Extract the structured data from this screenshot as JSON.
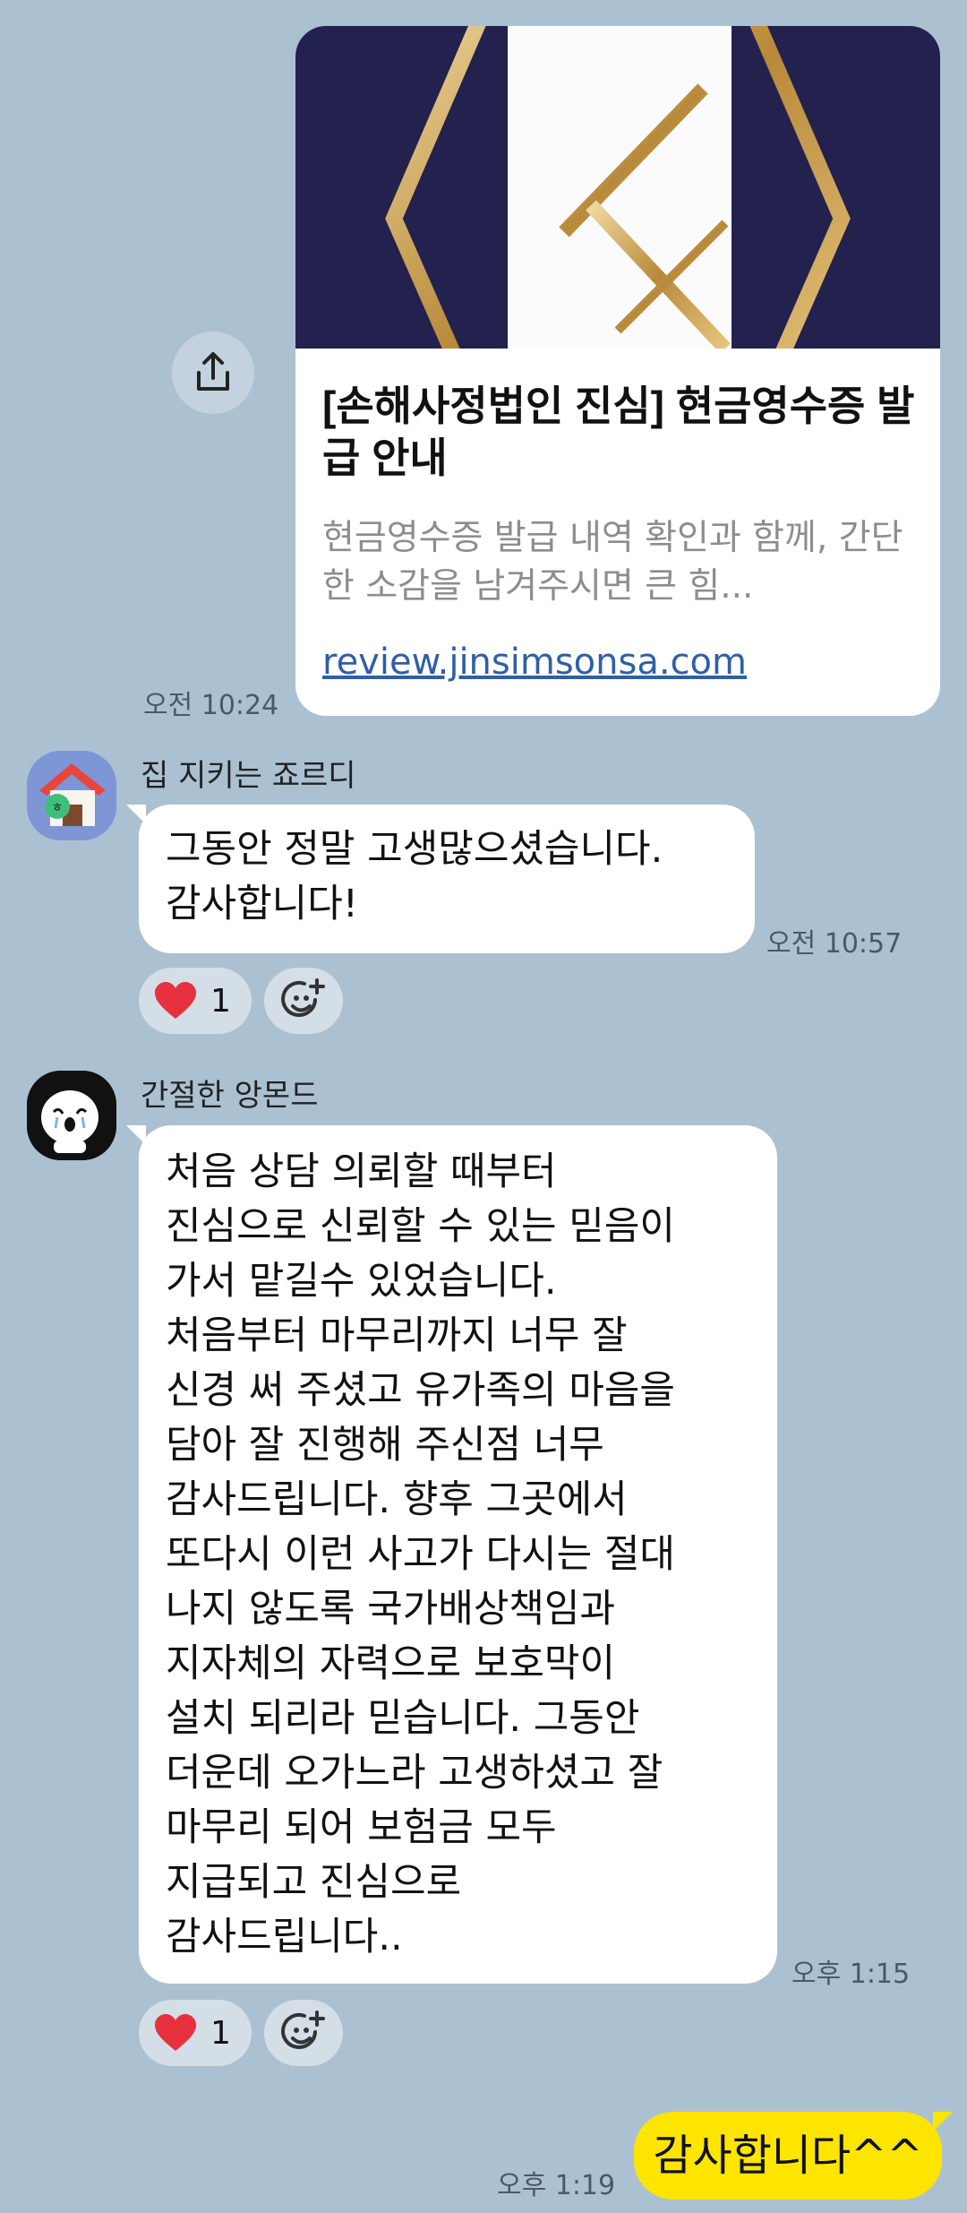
{
  "link_card": {
    "title": "[손해사정법인 진심] 현금영수증 발급 안내",
    "description": "현금영수증 발급 내역 확인과 함께, 간단한 소감을 남겨주시면 큰 힘...",
    "url": "review.jinsimsonsa.com",
    "time": "오전 10:24",
    "share_icon": "share-icon"
  },
  "messages": [
    {
      "sender": "집 지키는 죠르디",
      "avatar_icon": "house-character-avatar",
      "text": "그동안 정말 고생많으셨습니다.\n감사합니다!",
      "time": "오전 10:57",
      "reaction": {
        "icon": "heart-icon",
        "count": "1"
      },
      "add_reaction_icon": "add-emoji-icon"
    },
    {
      "sender": "간절한 앙몬드",
      "avatar_icon": "crying-character-avatar",
      "text": "처음 상담 의뢰할 때부터\n진심으로 신뢰할 수 있는 믿음이\n가서 맡길수 있었습니다.\n처음부터 마무리까지 너무 잘\n신경 써 주셨고 유가족의 마음을\n담아 잘 진행해 주신점 너무\n감사드립니다. 향후 그곳에서\n또다시 이런 사고가 다시는 절대\n나지 않도록 국가배상책임과\n지자체의  자력으로 보호막이\n설치 되리라 믿습니다. 그동안\n더운데 오가느라 고생하셨고 잘\n마무리 되어 보험금 모두\n지급되고 진심으로\n감사드립니다..",
      "time": "오후 1:15",
      "reaction": {
        "icon": "heart-icon",
        "count": "1"
      },
      "add_reaction_icon": "add-emoji-icon"
    }
  ],
  "my_message": {
    "text": "감사합니다^^",
    "time": "오후 1:19"
  },
  "colors": {
    "background": "#abc1d1",
    "my_bubble": "#fee500",
    "other_bubble": "#ffffff",
    "link": "#2f5fa7",
    "heart": "#e8313f"
  }
}
